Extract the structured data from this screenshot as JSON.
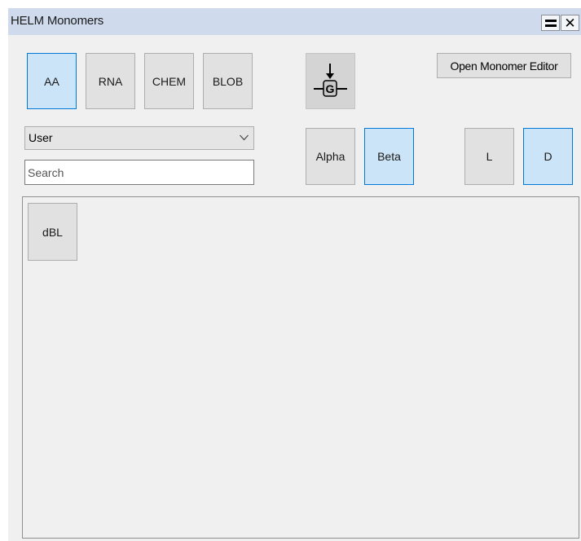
{
  "window": {
    "title": "HELM Monomers"
  },
  "type_buttons": [
    {
      "label": "AA",
      "selected": true
    },
    {
      "label": "RNA",
      "selected": false
    },
    {
      "label": "CHEM",
      "selected": false
    },
    {
      "label": "BLOB",
      "selected": false
    }
  ],
  "toolbar": {
    "g_icon": "monomer-attach-g-icon",
    "open_editor_label": "Open Monomer Editor"
  },
  "source_select": {
    "value": "User"
  },
  "search": {
    "placeholder": "Search"
  },
  "stereo_buttons": [
    {
      "label": "Alpha",
      "selected": false
    },
    {
      "label": "Beta",
      "selected": true
    }
  ],
  "chirality_buttons": [
    {
      "label": "L",
      "selected": false
    },
    {
      "label": "D",
      "selected": true
    }
  ],
  "monomers": [
    {
      "label": "dBL"
    }
  ],
  "colors": {
    "selected_fill": "#cce4f7",
    "selected_border": "#0078d7",
    "titlebar": "#cfdaec"
  }
}
